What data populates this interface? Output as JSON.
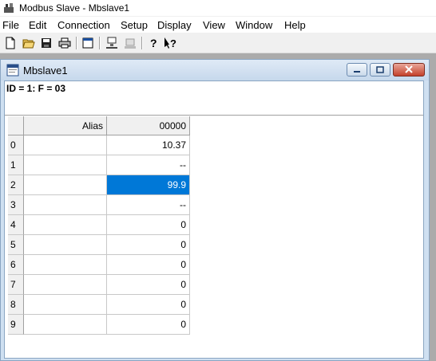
{
  "app": {
    "title": "Modbus Slave - Mbslave1"
  },
  "menu": [
    "File",
    "Edit",
    "Connection",
    "Setup",
    "Display",
    "View",
    "Window",
    "Help"
  ],
  "toolbar": {
    "icons": [
      "new-icon",
      "open-icon",
      "save-icon",
      "print-icon",
      "window-icon",
      "connect-icon",
      "disconnect-icon",
      "help-icon",
      "context-help-icon"
    ]
  },
  "child": {
    "title": "Mbslave1",
    "status": "ID = 1: F = 03",
    "grid": {
      "alias_header": "Alias",
      "address_header": "00000",
      "selected_row": 2,
      "rows": [
        {
          "num": "0",
          "alias": "",
          "value": "10.37"
        },
        {
          "num": "1",
          "alias": "",
          "value": "--"
        },
        {
          "num": "2",
          "alias": "",
          "value": "99.9"
        },
        {
          "num": "3",
          "alias": "",
          "value": "--"
        },
        {
          "num": "4",
          "alias": "",
          "value": "0"
        },
        {
          "num": "5",
          "alias": "",
          "value": "0"
        },
        {
          "num": "6",
          "alias": "",
          "value": "0"
        },
        {
          "num": "7",
          "alias": "",
          "value": "0"
        },
        {
          "num": "8",
          "alias": "",
          "value": "0"
        },
        {
          "num": "9",
          "alias": "",
          "value": "0"
        }
      ]
    }
  }
}
